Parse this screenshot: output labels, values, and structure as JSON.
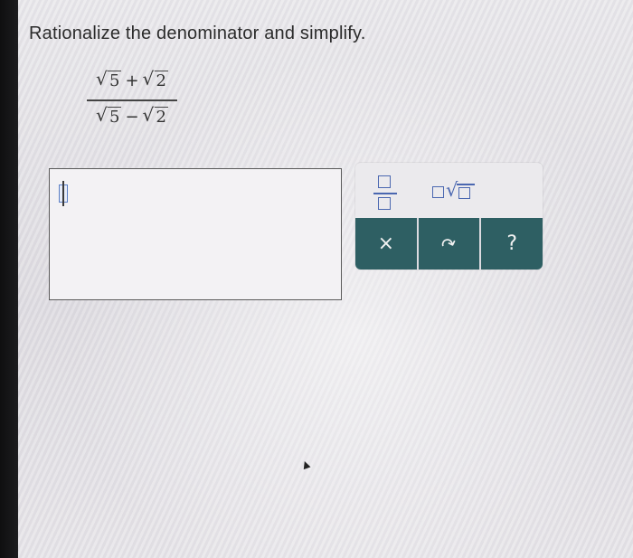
{
  "question": {
    "prompt": "Rationalize the denominator and simplify.",
    "numerator": {
      "radicand_a": "5",
      "operator": "+",
      "radicand_b": "2"
    },
    "denominator": {
      "radicand_a": "5",
      "operator": "−",
      "radicand_b": "2"
    }
  },
  "answer": {
    "value": ""
  },
  "keypad": {
    "tools": [
      {
        "name": "fraction-template",
        "icon": "fraction-icon"
      },
      {
        "name": "multiply-radical-template",
        "icon": "radical-icon"
      }
    ],
    "actions": [
      {
        "name": "clear",
        "label": "×",
        "icon": "close-icon"
      },
      {
        "name": "undo",
        "label": "↶",
        "icon": "undo-icon"
      },
      {
        "name": "help",
        "label": "?",
        "icon": "help-icon"
      }
    ]
  },
  "colors": {
    "action_bar": "#2e5f63",
    "tool_blue": "#4a67b0",
    "text": "#2b2b2b"
  }
}
